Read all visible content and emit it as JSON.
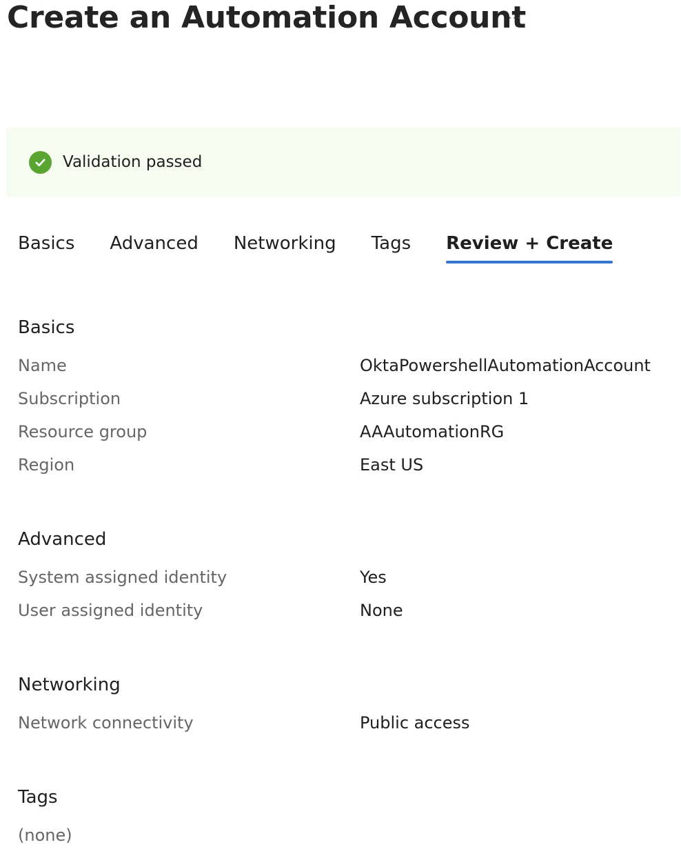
{
  "header": {
    "title": "Create an Automation Account",
    "more_label": "···"
  },
  "banner": {
    "status_icon": "check-circle-icon",
    "text": "Validation passed",
    "accent": "#5aa431",
    "background": "#f7fcf0"
  },
  "tabs": [
    {
      "label": "Basics"
    },
    {
      "label": "Advanced"
    },
    {
      "label": "Networking"
    },
    {
      "label": "Tags"
    },
    {
      "label": "Review + Create",
      "active": true
    }
  ],
  "colors": {
    "active_tab_underline": "#3577cc"
  },
  "sections": {
    "basics": {
      "title": "Basics",
      "rows": [
        {
          "label": "Name",
          "value": "OktaPowershellAutomationAccount"
        },
        {
          "label": "Subscription",
          "value": "Azure subscription 1"
        },
        {
          "label": "Resource group",
          "value": "AAAutomationRG"
        },
        {
          "label": "Region",
          "value": "East US"
        }
      ]
    },
    "advanced": {
      "title": "Advanced",
      "rows": [
        {
          "label": "System assigned identity",
          "value": "Yes"
        },
        {
          "label": "User assigned identity",
          "value": "None"
        }
      ]
    },
    "networking": {
      "title": "Networking",
      "rows": [
        {
          "label": "Network connectivity",
          "value": "Public access"
        }
      ]
    },
    "tags": {
      "title": "Tags",
      "empty_text": "(none)"
    }
  }
}
